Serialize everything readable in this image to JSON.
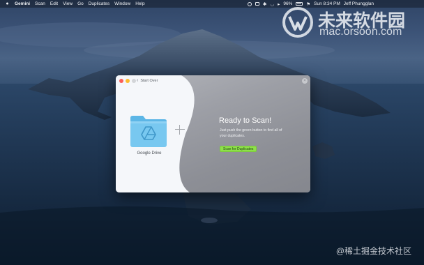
{
  "menubar": {
    "app_name": "Gemini",
    "items": [
      "Scan",
      "Edit",
      "View",
      "Go",
      "Duplicates",
      "Window",
      "Help"
    ],
    "battery": "96%",
    "clock": "Sun 8:34 PM",
    "user": "Jeff Phungglan"
  },
  "watermark": {
    "cn_text": "未来软件园",
    "url": "mac.orsoon.com",
    "bottom_text": "@稀土掘金技术社区"
  },
  "window": {
    "back_label": "Start Over",
    "source": {
      "label": "Google Drive",
      "icon": "google-drive-folder-icon"
    },
    "heading": "Ready to Scan!",
    "description": "Just push the green button to find all of your duplicates.",
    "scan_button": "Scan for Duplicates"
  },
  "colors": {
    "scan_button": "#8ee04a",
    "folder": "#6ec3ee",
    "close_red": "#fc5e57",
    "minimize_yellow": "#fdbc2e"
  }
}
